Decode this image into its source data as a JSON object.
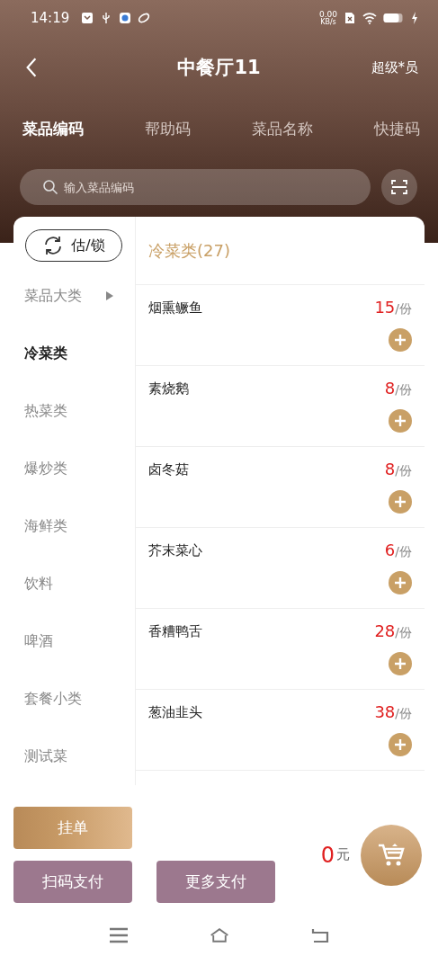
{
  "status_bar": {
    "time": "14:19",
    "net_speed": "0.00",
    "net_unit": "KB/s"
  },
  "nav": {
    "title": "中餐厅11",
    "user": "超级*员"
  },
  "tabs": [
    {
      "label": "菜品编码",
      "selected": true
    },
    {
      "label": "帮助码",
      "selected": false
    },
    {
      "label": "菜品名称",
      "selected": false
    },
    {
      "label": "快捷码",
      "selected": false
    }
  ],
  "search": {
    "placeholder": "输入菜品编码"
  },
  "sidebar": {
    "action_button": "估/锁",
    "categories": [
      {
        "label": "菜品大类",
        "kind": "group",
        "selected": false
      },
      {
        "label": "冷菜类",
        "kind": "item",
        "selected": true
      },
      {
        "label": "热菜类",
        "kind": "item",
        "selected": false
      },
      {
        "label": "爆炒类",
        "kind": "item",
        "selected": false
      },
      {
        "label": "海鲜类",
        "kind": "item",
        "selected": false
      },
      {
        "label": "饮料",
        "kind": "item",
        "selected": false
      },
      {
        "label": "啤酒",
        "kind": "item",
        "selected": false
      },
      {
        "label": "套餐小类",
        "kind": "item",
        "selected": false
      },
      {
        "label": "测试菜",
        "kind": "item",
        "selected": false
      }
    ]
  },
  "dish_list": {
    "header": "冷菜类(27)",
    "items": [
      {
        "name": "烟熏鳜鱼",
        "price": "15",
        "unit": "/份"
      },
      {
        "name": "素烧鹅",
        "price": "8",
        "unit": "/份"
      },
      {
        "name": "卤冬菇",
        "price": "8",
        "unit": "/份"
      },
      {
        "name": "芥末菜心",
        "price": "6",
        "unit": "/份"
      },
      {
        "name": "香糟鸭舌",
        "price": "28",
        "unit": "/份"
      },
      {
        "name": "葱油韭头",
        "price": "38",
        "unit": "/份"
      }
    ]
  },
  "footer": {
    "hold_button": "挂单",
    "pay_buttons": [
      "扫码支付",
      "更多支付"
    ],
    "total": "0",
    "currency": "元"
  }
}
